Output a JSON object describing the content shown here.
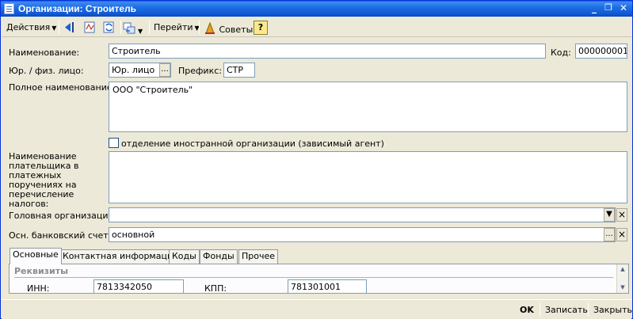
{
  "window": {
    "title": "Организации: Строитель",
    "minimize": "_",
    "restore": "❐",
    "close": "✕"
  },
  "toolbar": {
    "actions": "Действия",
    "goto": "Перейти",
    "tips": "Советы",
    "help": "?"
  },
  "form": {
    "name_label": "Наименование:",
    "name_value": "Строитель",
    "code_label": "Код:",
    "code_value": "000000001",
    "entity_label": "Юр. / физ. лицо:",
    "entity_value": "Юр. лицо",
    "select_dots": "...",
    "prefix_label": "Префикс:",
    "prefix_value": "СТР",
    "full_name_label": "Полное наименование:",
    "full_name_value": "ООО \"Строитель\"",
    "foreign_checkbox_label": "отделение иностранной организации (зависимый агент)",
    "foreign_checked": false,
    "payer_label": "Наименование плательщика в платежных поручениях на перечисление налогов:",
    "payer_value": "",
    "head_org_label": "Головная организация:",
    "head_org_value": "",
    "bank_label": "Осн. банковский счет:",
    "bank_value": "основной",
    "clear_x": "×",
    "dropdown_arrow": "▼"
  },
  "tabs": [
    {
      "label": "Основные",
      "active": true
    },
    {
      "label": "Контактная информация",
      "active": false
    },
    {
      "label": "Коды",
      "active": false
    },
    {
      "label": "Фонды",
      "active": false
    },
    {
      "label": "Прочее",
      "active": false
    }
  ],
  "requisites": {
    "group_title": "Реквизиты",
    "inn_label": "ИНН:",
    "inn_value": "7813342050",
    "kpp_label": "КПП:",
    "kpp_value": "781301001"
  },
  "bottom": {
    "ok": "OK",
    "save": "Записать",
    "close": "Закрыть"
  },
  "icons": {
    "window": "document-list-icon",
    "back": "arrow-left-icon",
    "edit": "form-edit-icon",
    "refresh": "refresh-icon",
    "structure": "structure-icon",
    "tips": "wizard-hat-icon",
    "help": "help-icon"
  },
  "colors": {
    "titlebar": "#0e55d1",
    "face": "#ece9d8",
    "field_border": "#7f9db9"
  }
}
